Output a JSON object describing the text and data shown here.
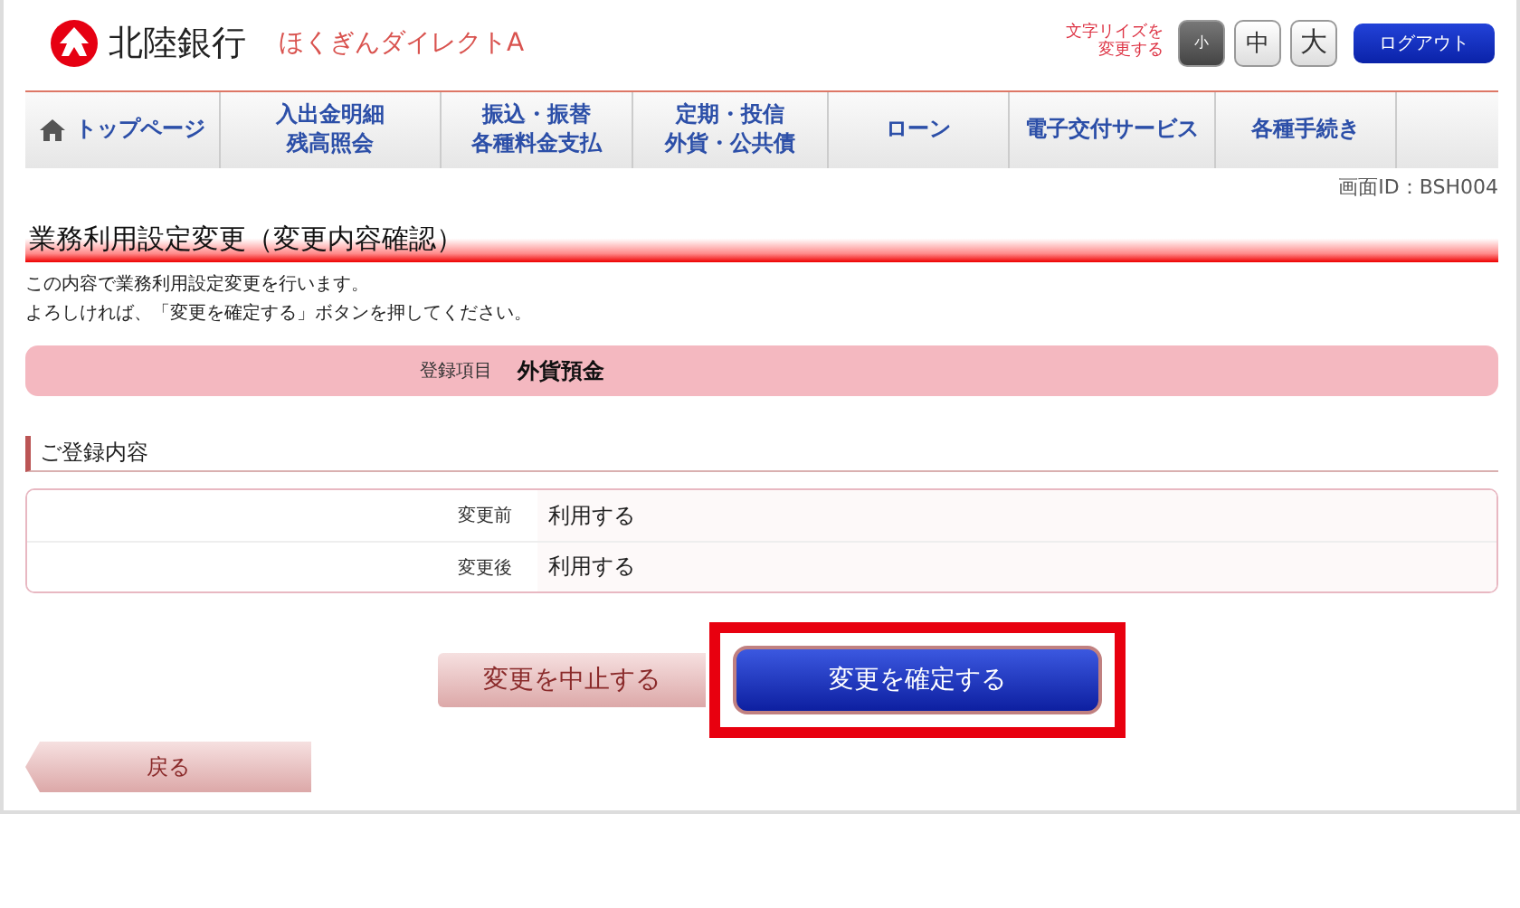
{
  "header": {
    "bank_name": "北陸銀行",
    "service_name": "ほくぎんダイレクトA",
    "font_size_label": [
      "文字リイズを",
      "変更する"
    ],
    "font_sizes": [
      {
        "label": "小",
        "selected": true
      },
      {
        "label": "中",
        "selected": false
      },
      {
        "label": "大",
        "selected": false
      }
    ],
    "logout": "ログアウト"
  },
  "nav": [
    {
      "label": [
        "トップページ"
      ],
      "kind": "home"
    },
    {
      "label": [
        "入出金明細",
        "残高照会"
      ],
      "kind": "text"
    },
    {
      "label": [
        "振込・振替",
        "各種料金支払"
      ],
      "kind": "text"
    },
    {
      "label": [
        "定期・投信",
        "外貨・公共債"
      ],
      "kind": "text"
    },
    {
      "label": [
        "ローン"
      ],
      "kind": "text"
    },
    {
      "label": [
        "電子交付サービス"
      ],
      "kind": "text"
    },
    {
      "label": [
        "各種手続き"
      ],
      "kind": "text"
    }
  ],
  "screen_id": "画面ID：BSH004",
  "page_title": "業務利用設定変更（変更内容確認）",
  "intro": [
    "この内容で業務利用設定変更を行います。",
    "よろしければ、「変更を確定する」ボタンを押してください。"
  ],
  "registration_item": {
    "label": "登録項目",
    "value": "外貨預金"
  },
  "section_title": "ご登録内容",
  "details": [
    {
      "label": "変更前",
      "value": "利用する"
    },
    {
      "label": "変更後",
      "value": "利用する"
    }
  ],
  "buttons": {
    "cancel": "変更を中止する",
    "confirm": {
      "label": "変更を確定する",
      "highlighted": true
    },
    "back": "戻る"
  }
}
